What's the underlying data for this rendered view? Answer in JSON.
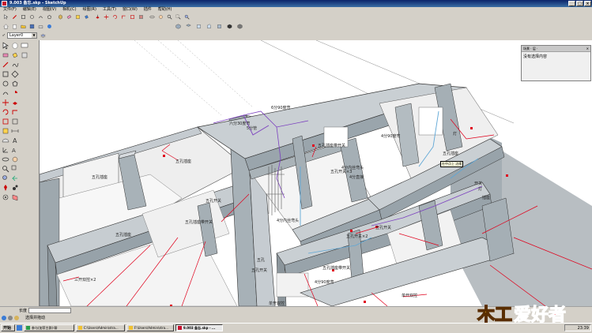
{
  "window": {
    "title": "9.003 备忘.skp - SketchUp",
    "min": "_",
    "max": "□",
    "close": "×"
  },
  "menus": [
    "文件(F)",
    "编辑(E)",
    "视图(V)",
    "相机(C)",
    "绘图(R)",
    "工具(T)",
    "窗口(W)",
    "插件",
    "帮助(H)"
  ],
  "layer": {
    "value": "Layer0"
  },
  "panel": {
    "title": "场景 · 层 ·",
    "close": "✕",
    "subtitle": "没有选择内容"
  },
  "tooltip": "在中点上 边缘",
  "labels": [
    {
      "text": "五孔插座"
    },
    {
      "text": "五孔插座"
    },
    {
      "text": "五孔插座"
    },
    {
      "text": "五孔插座带开关"
    },
    {
      "text": "五孔插座带开关"
    },
    {
      "text": "五孔插座带开关"
    },
    {
      "text": "五孔开关"
    },
    {
      "text": "单开双控"
    },
    {
      "text": "三开双控×2"
    },
    {
      "text": "六分30度弯"
    },
    {
      "text": "6分90度弯"
    },
    {
      "text": "4分内丝弯头"
    },
    {
      "text": "4分内丝弯头"
    },
    {
      "text": "4分90度弯"
    },
    {
      "text": "4分直接"
    },
    {
      "text": "五孔开关×3"
    },
    {
      "text": "五孔开关×2"
    },
    {
      "text": "5分管"
    },
    {
      "text": "4分90度弯"
    },
    {
      "text": "五孔"
    },
    {
      "text": "开关"
    },
    {
      "text": "五孔开关"
    },
    {
      "text": "五孔开关"
    },
    {
      "text": "灯"
    },
    {
      "text": "灯"
    },
    {
      "text": "插座"
    },
    {
      "text": "五孔插座"
    },
    {
      "text": "单开双控"
    }
  ],
  "measurements": {
    "label": "长度"
  },
  "status": {
    "text": "选择并拖动"
  },
  "taskbar": {
    "start": "开始",
    "tasks": [
      "参与(加菲主群)·聊",
      "C:\\Users\\Admin\\stra...",
      "F:\\Users\\Admin\\stra...",
      "9.003 备忘.skp - ..."
    ],
    "clock": "23:39"
  },
  "logo": {
    "text": "木工爱好者"
  },
  "colors": {
    "title_bar": "#0a246a",
    "chrome": "#d4d0c8",
    "viewport_bg": "#ffffff",
    "wall_top": "#c9cfd3",
    "wall_side": "#9ba6ad",
    "annotation_red": "#e0001b",
    "pipe_purple": "#7b3fbf",
    "pipe_blue": "#5fa7d6"
  }
}
